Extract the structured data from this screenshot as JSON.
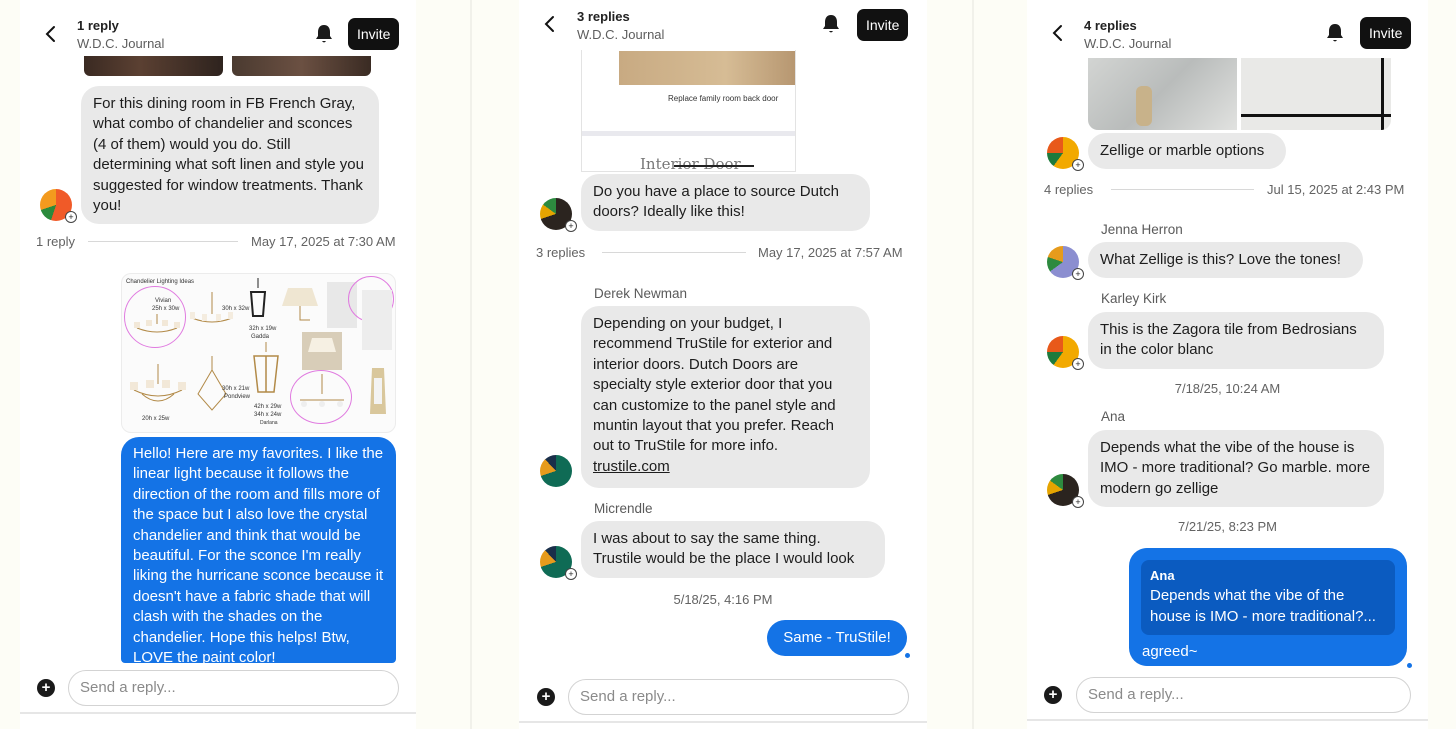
{
  "panel1": {
    "header": {
      "title": "1 reply",
      "subtitle": "W.D.C. Journal",
      "invite_label": "Invite"
    },
    "question": "For this dining room in FB French Gray, what combo of chandelier and sconces (4 of them) would you do. Still determining what soft linen and style you suggested for window treatments. Thank you!",
    "reply_count": "1 reply",
    "timestamp": "May 17, 2025 at 7:30 AM",
    "collage": {
      "title": "Chandelier Lighting Ideas",
      "labels": [
        "Vivian",
        "25h x 30w",
        "30h x 32w",
        "32h x 19w",
        "Gadda",
        "30h x 21w",
        "Pondview",
        "42h x 29w",
        "34h x 24w",
        "Darlana",
        "20h x 25w"
      ]
    },
    "answer": "Hello! Here are my favorites. I like the linear light because it follows the direction of the room and fills more of the space but I also love the crystal chandelier and think that would be beautiful. For the sconce I'm really liking the hurricane sconce because it doesn't have a fabric shade that will clash with the shades on the chandelier. Hope this helps! Btw, LOVE the paint color!",
    "composer_placeholder": "Send a reply..."
  },
  "panel2": {
    "header": {
      "title": "3 replies",
      "subtitle": "W.D.C. Journal",
      "invite_label": "Invite"
    },
    "image_caption": "Replace family room back door",
    "image_heading": "Interior Door Hardw",
    "question": "Do you have a place to source Dutch doors? Ideally like this!",
    "reply_count": "3 replies",
    "timestamp": "May 17, 2025 at 7:57 AM",
    "messages": [
      {
        "author": "Derek Newman",
        "text": "Depending on your budget, I recommend TruStile for exterior and interior doors. Dutch Doors are specialty style exterior door that you can customize to the panel style and muntin layout that you prefer. Reach out to TruStile for more info.",
        "link": "trustile.com"
      },
      {
        "author": "Micrendle",
        "text": "I was about to say the same thing. Trustile would be the place I would look"
      }
    ],
    "time_divider": "5/18/25, 4:16 PM",
    "own_message": "Same - TruStile!",
    "composer_placeholder": "Send a reply..."
  },
  "panel3": {
    "header": {
      "title": "4 replies",
      "subtitle": "W.D.C. Journal",
      "invite_label": "Invite"
    },
    "question": "Zellige or marble options",
    "reply_count": "4 replies",
    "timestamp": "Jul 15, 2025 at 2:43 PM",
    "messages": [
      {
        "author": "Jenna Herron",
        "text": "What Zellige is this? Love the tones!"
      },
      {
        "author": "Karley Kirk",
        "text": "This is the Zagora tile from Bedrosians in the color blanc"
      },
      {
        "author": "Ana",
        "text": "Depends what the vibe of the house is IMO - more traditional? Go marble. more modern go zellige"
      }
    ],
    "time_divider_1": "7/18/25, 10:24 AM",
    "time_divider_2": "7/21/25, 8:23 PM",
    "own_reply": {
      "quoted_author": "Ana",
      "quoted_text": "Depends what the vibe of the house is IMO - more traditional?...",
      "text": "agreed~"
    },
    "composer_placeholder": "Send a reply..."
  },
  "icons": {
    "back": "chevron-left-icon",
    "bell": "bell-icon",
    "plus": "plus-circle-icon"
  },
  "colors": {
    "own_bubble": "#1473e6",
    "other_bubble": "#e9e9e9",
    "invite_bg": "#111111",
    "page_bg": "#fdfdf6"
  }
}
